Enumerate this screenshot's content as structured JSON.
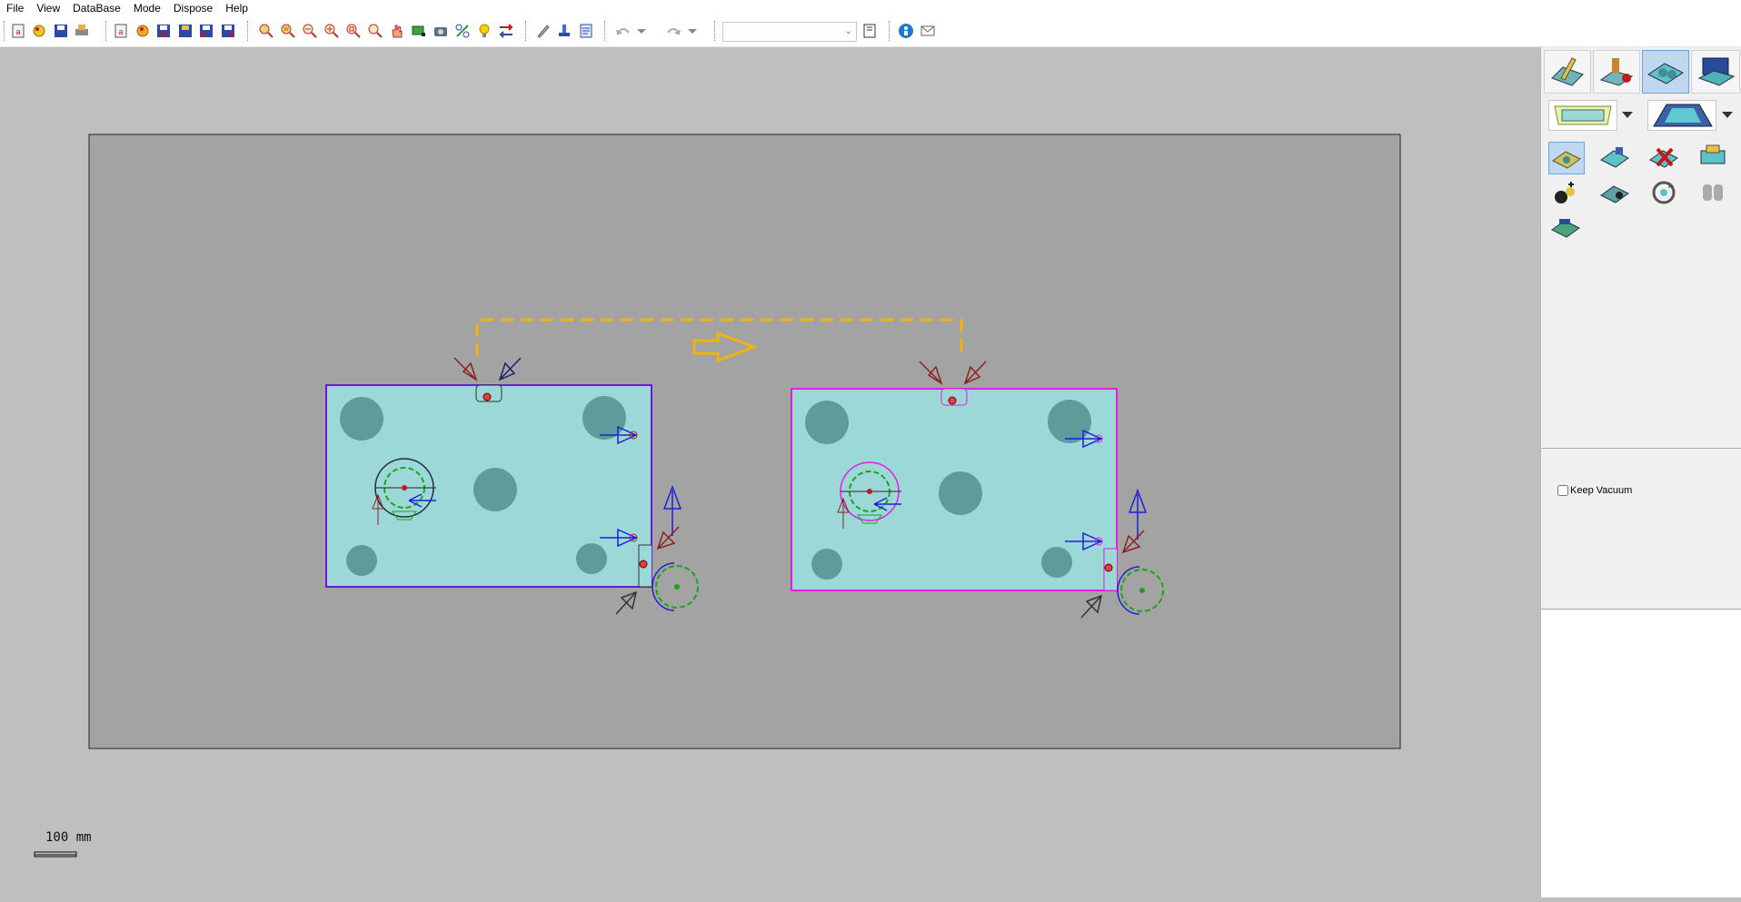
{
  "menu": [
    "File",
    "View",
    "DataBase",
    "Mode",
    "Dispose",
    "Help"
  ],
  "toolbar": {
    "groups": [
      [
        "new-icon",
        "open-icon",
        "save-icon",
        "print-icon"
      ],
      [
        "db-new-icon",
        "db-open-icon",
        "db-save-icon",
        "db-save-as-icon",
        "db-export-icon",
        "db-import-icon"
      ],
      [
        "zoom-extents-icon",
        "zoom-window-icon",
        "zoom-out-icon",
        "zoom-in-icon",
        "zoom-fit-icon",
        "zoom-prev-icon",
        "pan-icon",
        "rectangle-icon",
        "camera-icon",
        "tool-icon",
        "bulb-icon",
        "swap-icon"
      ],
      [
        "pencil-icon",
        "stamp-icon",
        "report-icon"
      ],
      [
        "undo-icon",
        "redo-icon"
      ]
    ],
    "combo_value": "",
    "info_icon": "info-icon",
    "mail_icon": "mail-icon"
  },
  "scale_label": "100  mm",
  "right_panel": {
    "mode_buttons": [
      "edit-mode-icon",
      "machine-mode-icon",
      "table-mode-icon",
      "simulation-mode-icon"
    ],
    "selected_mode": 2,
    "tools": [
      "select-tool-icon",
      "place-tool-icon",
      "delete-tool-icon",
      "move-tool-icon",
      "cup-tool-icon",
      "clamp-tool-icon",
      "rotate-tool-icon",
      "pods-tool-icon",
      "pattern-tool-icon"
    ],
    "keep_vacuum_label": "Keep Vacuum",
    "keep_vacuum_checked": false
  },
  "colors": {
    "panel": "#9dd8d8",
    "pod": "#5e9c9c",
    "outline_left": "#6f17d6",
    "outline_right": "#e11ee1",
    "path": "#f0b40c",
    "field": "#a4a3a4"
  }
}
